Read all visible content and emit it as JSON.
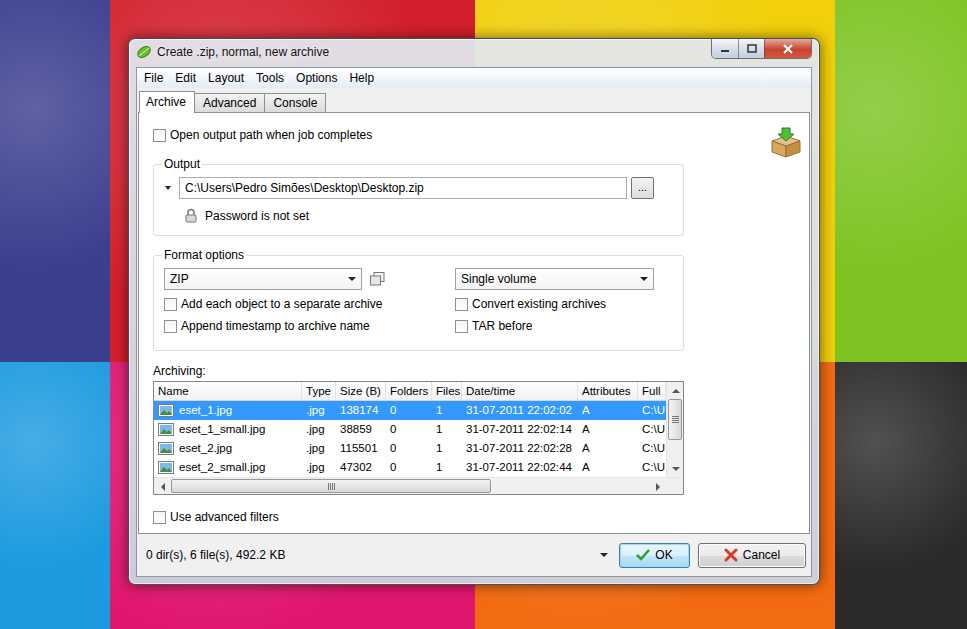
{
  "window": {
    "title": "Create .zip, normal, new archive"
  },
  "menu": [
    "File",
    "Edit",
    "Layout",
    "Tools",
    "Options",
    "Help"
  ],
  "tabs": [
    {
      "label": "Archive",
      "selected": true
    },
    {
      "label": "Advanced",
      "selected": false
    },
    {
      "label": "Console",
      "selected": false
    }
  ],
  "open_output": {
    "label": "Open output path when job completes",
    "checked": false
  },
  "output": {
    "legend": "Output",
    "path": "C:\\Users\\Pedro Simões\\Desktop\\Desktop.zip",
    "browse": "...",
    "password": "Password is not set"
  },
  "format_options": {
    "legend": "Format options",
    "format": "ZIP",
    "volume": "Single volume",
    "checkboxes": [
      {
        "label": "Add each object to a separate archive",
        "checked": false
      },
      {
        "label": "Convert existing archives",
        "checked": false
      },
      {
        "label": "Append timestamp to archive name",
        "checked": false
      },
      {
        "label": "TAR before",
        "checked": false
      }
    ]
  },
  "archiving": {
    "label": "Archiving:",
    "columns": [
      "Name",
      "Type",
      "Size (B)",
      "Folders",
      "Files",
      "Date/time",
      "Attributes",
      "Full"
    ],
    "rows": [
      {
        "cells": [
          "eset_1.jpg",
          ".jpg",
          "138174",
          "0",
          "1",
          "31-07-2011 22:02:02",
          "A",
          "C:\\U"
        ],
        "selected": true
      },
      {
        "cells": [
          "eset_1_small.jpg",
          ".jpg",
          "38859",
          "0",
          "1",
          "31-07-2011 22:02:14",
          "A",
          "C:\\U"
        ],
        "selected": false
      },
      {
        "cells": [
          "eset_2.jpg",
          ".jpg",
          "115501",
          "0",
          "1",
          "31-07-2011 22:02:28",
          "A",
          "C:\\U"
        ],
        "selected": false
      },
      {
        "cells": [
          "eset_2_small.jpg",
          ".jpg",
          "47302",
          "0",
          "1",
          "31-07-2011 22:02:44",
          "A",
          "C:\\U"
        ],
        "selected": false
      }
    ],
    "scrollbars": {
      "vertical": {
        "level": 0.67
      },
      "horizontal": {
        "level": 0.67
      }
    }
  },
  "advanced_filters": {
    "label": "Use advanced filters",
    "checked": false
  },
  "status_bar": {
    "summary": "0 dir(s), 6 file(s), 492.2 KB"
  },
  "buttons": [
    {
      "label": "OK",
      "kind": "ok"
    },
    {
      "label": "Cancel",
      "kind": "cancel"
    }
  ]
}
